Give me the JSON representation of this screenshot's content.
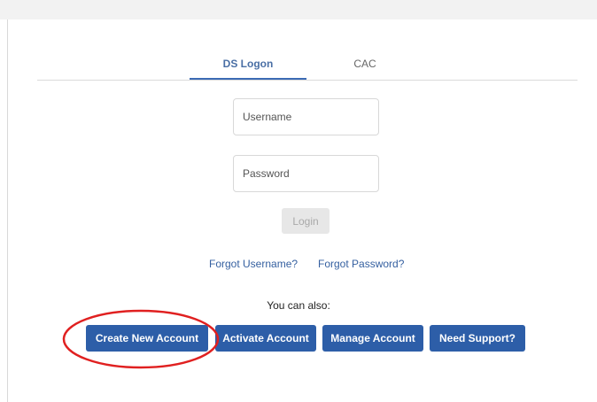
{
  "tabs": [
    {
      "label": "DS Logon",
      "active": true
    },
    {
      "label": "CAC",
      "active": false
    }
  ],
  "form": {
    "username_placeholder": "Username",
    "password_placeholder": "Password",
    "login_label": "Login"
  },
  "links": {
    "forgot_username": "Forgot Username?",
    "forgot_password": "Forgot Password?"
  },
  "also_text": "You can also:",
  "actions": {
    "create": "Create New Account",
    "activate": "Activate Account",
    "manage": "Manage Account",
    "support": "Need Support?"
  },
  "colors": {
    "primary_button": "#2d5ea8",
    "link": "#3560a0",
    "active_tab": "#4a6fa5",
    "annotation": "#e02020"
  }
}
